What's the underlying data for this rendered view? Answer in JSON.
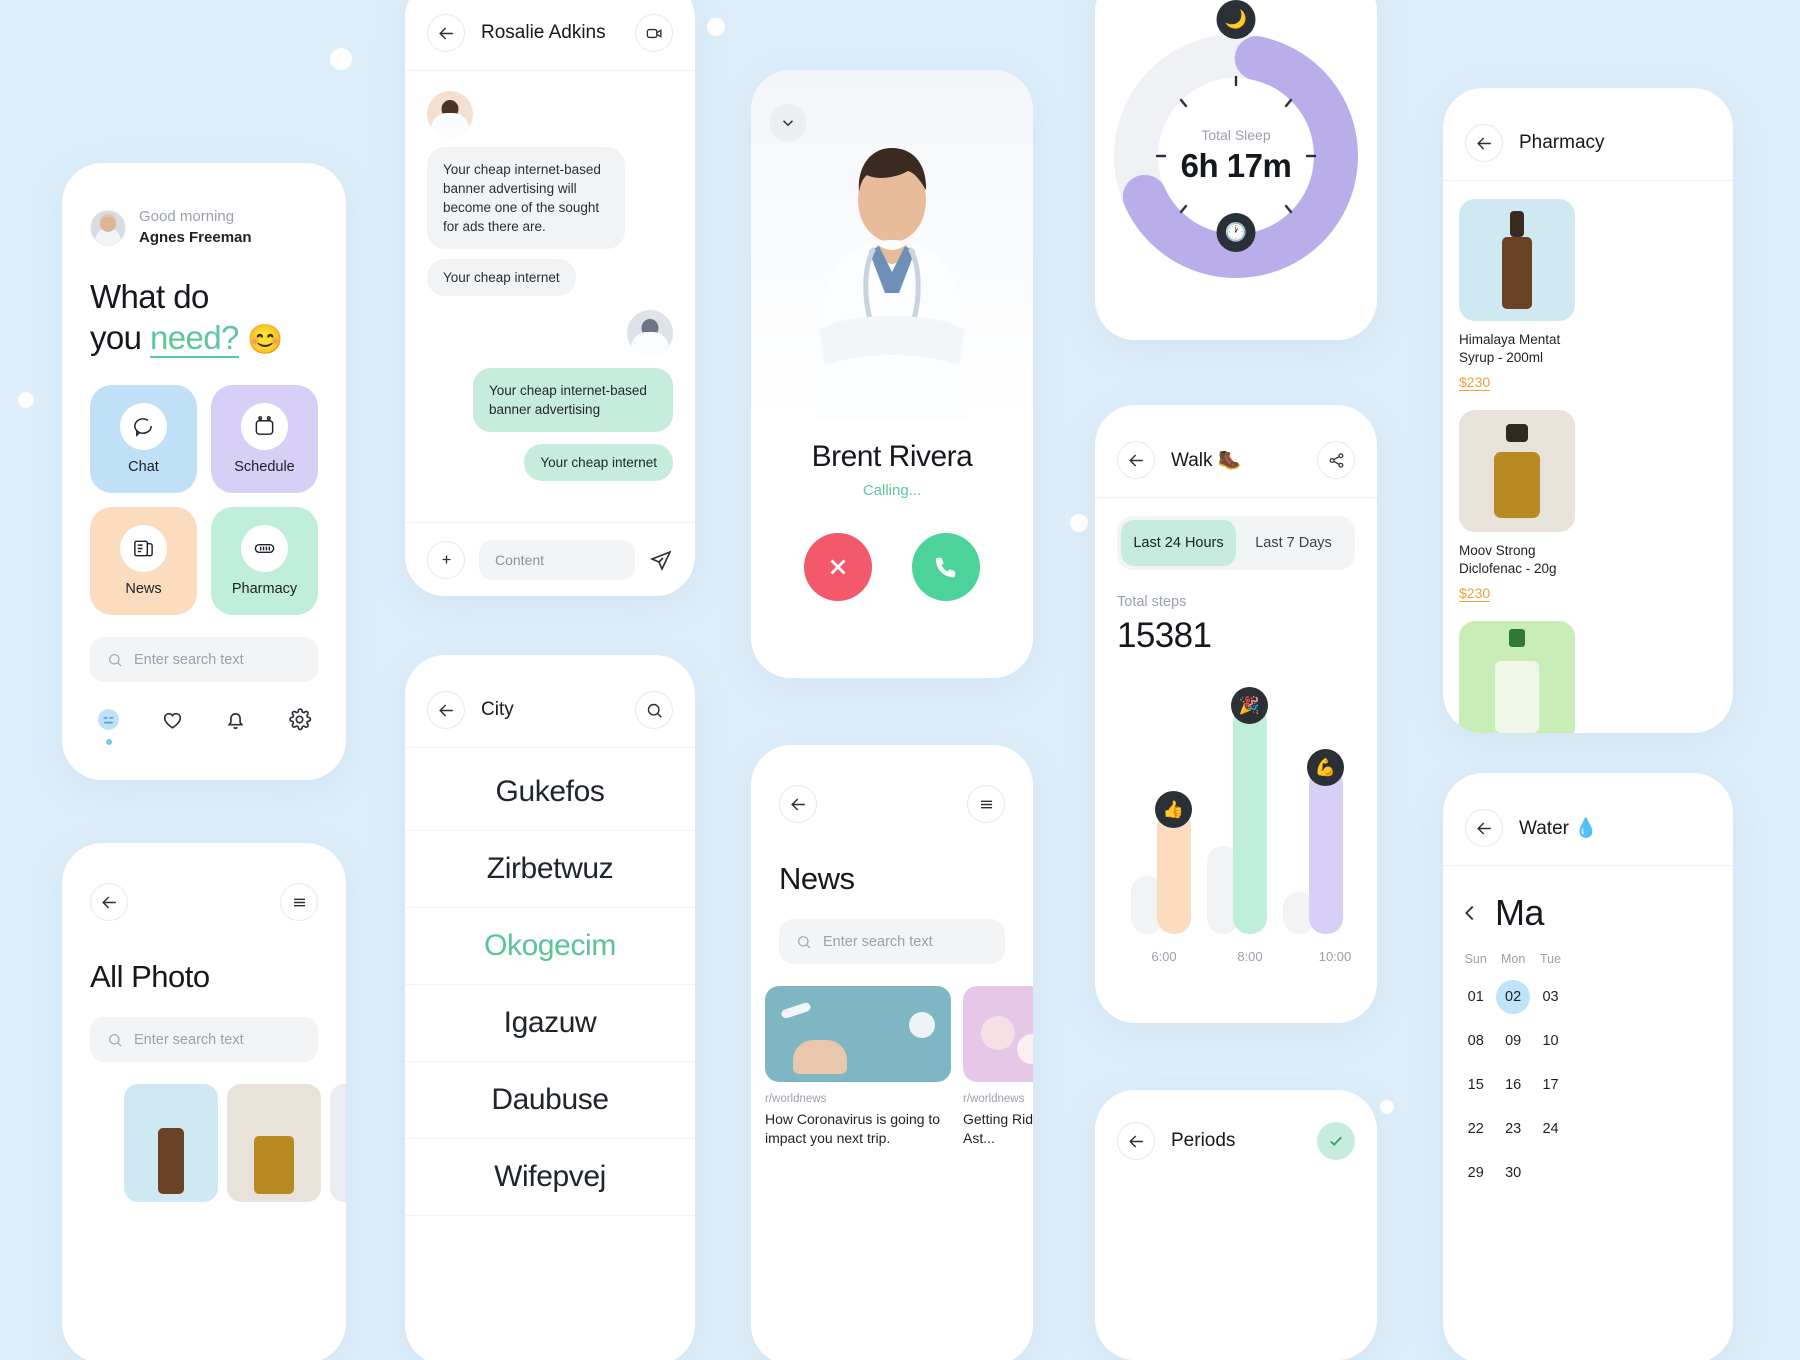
{
  "theme": {
    "bg": "#ddeefa",
    "accent_green": "#5cc79b",
    "mint": "#c6ecdd",
    "blue_tile": "#bfe0f7",
    "purple_tile": "#d7cff5",
    "peach_tile": "#fbdcbf",
    "ring_purple": "#b9aeea",
    "price_gold": "#e8a33d"
  },
  "home": {
    "greeting": "Good morning",
    "user_name": "Agnes Freeman",
    "headline_1": "What do",
    "headline_2": "you ",
    "headline_link": "need?",
    "headline_emoji": "😊",
    "tiles": [
      {
        "label": "Chat",
        "icon": "chat-bubble-icon",
        "color": "#bfe0f7"
      },
      {
        "label": "Schedule",
        "icon": "calendar-icon",
        "color": "#d7cff5"
      },
      {
        "label": "News",
        "icon": "newspaper-icon",
        "color": "#fbdcbf"
      },
      {
        "label": "Pharmacy",
        "icon": "pill-capsule-icon",
        "color": "#bfeeda"
      }
    ],
    "search_placeholder": "Enter search text",
    "nav": [
      {
        "name": "smiley-face-icon",
        "active": true
      },
      {
        "name": "heart-icon",
        "active": false
      },
      {
        "name": "bell-icon",
        "active": false
      },
      {
        "name": "gear-icon",
        "active": false
      }
    ]
  },
  "photo": {
    "title": "All Photo",
    "search_placeholder": "Enter search text",
    "back_icon": "back-arrow-icon",
    "menu_icon": "hamburger-menu-icon",
    "thumbs": [
      {
        "bg": "#cfe9f2",
        "bottle": "#6b4224"
      },
      {
        "bg": "#e8e3da",
        "bottle": "#b98a22"
      },
      {
        "bg": "#e9edf0",
        "bottle": "#ffffff"
      }
    ]
  },
  "chat": {
    "contact_name": "Rosalie Adkins",
    "back_icon": "back-arrow-icon",
    "video_icon": "video-camera-icon",
    "messages": [
      {
        "side": "in",
        "text": "Your cheap internet-based banner advertising will become one of the sought for ads there are."
      },
      {
        "side": "in",
        "text": "Your cheap internet"
      },
      {
        "side": "out",
        "text": "Your cheap internet-based banner advertising"
      },
      {
        "side": "out",
        "text": "Your cheap internet"
      }
    ],
    "input_placeholder": "Content",
    "plus_icon": "plus-circle-icon",
    "send_icon": "send-paper-plane-icon"
  },
  "city": {
    "title": "City",
    "back_icon": "back-arrow-icon",
    "search_icon": "search-icon",
    "items": [
      {
        "name": "Gukefos",
        "selected": false
      },
      {
        "name": "Zirbetwuz",
        "selected": false
      },
      {
        "name": "Okogecim",
        "selected": true
      },
      {
        "name": "Igazuw",
        "selected": false
      },
      {
        "name": "Daubuse",
        "selected": false
      },
      {
        "name": "Wifepvej",
        "selected": false
      }
    ]
  },
  "call": {
    "doctor_name": "Brent Rivera",
    "status": "Calling...",
    "collapse_icon": "chevron-down-icon",
    "decline_icon": "close-x-icon",
    "accept_icon": "phone-icon",
    "decline_color": "#f3586b",
    "accept_color": "#4bd39b"
  },
  "news": {
    "title": "News",
    "search_placeholder": "Enter search text",
    "back_icon": "back-arrow-icon",
    "menu_icon": "hamburger-menu-icon",
    "articles": [
      {
        "source": "r/worldnews",
        "headline": "How Coronavirus is going to impact you next trip.",
        "img": "#7fb6c4"
      },
      {
        "source": "r/worldnews",
        "headline": "Getting Rid Of Worries On Ast...",
        "img": "#e6c7e8"
      }
    ]
  },
  "sleep": {
    "label": "Total Sleep",
    "value": "6h 17m",
    "moon_icon": "🌙",
    "clock_icon": "🕐",
    "ring_color": "#b9aeea",
    "track_color": "#f0f1f4"
  },
  "walk": {
    "title": "Walk",
    "title_emoji": "🥾",
    "back_icon": "back-arrow-icon",
    "share_icon": "share-icon",
    "tabs": [
      {
        "label": "Last 24 Hours",
        "active": true
      },
      {
        "label": "Last 7 Days",
        "active": false
      }
    ],
    "total_label": "Total steps",
    "total_value": "15381"
  },
  "chart_data": {
    "type": "bar",
    "title": "Total steps",
    "categories": [
      "6:00",
      "8:00",
      "10:00"
    ],
    "values": [
      2900,
      6600,
      4300
    ],
    "ylim": [
      0,
      7200
    ],
    "xlabel": "",
    "ylabel": "",
    "grid": false,
    "legend": "none",
    "series": [
      {
        "name": "steps",
        "values": [
          2900,
          6600,
          4300
        ]
      }
    ],
    "bar_colors": [
      "#fbdcbf",
      "#bfeeda",
      "#d7cff5"
    ],
    "bar_badges": [
      "👍",
      "🎉",
      "💪"
    ],
    "ghost_bars": [
      1400,
      2100,
      1000
    ],
    "ghost_color": "#f2f3f5",
    "tick_labels": [
      "6:00",
      "8:00",
      "10:00"
    ]
  },
  "periods": {
    "title": "Periods",
    "back_icon": "back-arrow-icon",
    "check_icon": "check-icon"
  },
  "pharmacy": {
    "title": "Pharmacy",
    "back_icon": "back-arrow-icon",
    "products": [
      {
        "name": "Himalaya Mentat Syrup - 200ml",
        "price": "$230",
        "bg": "#cfe9f2",
        "bottle": "#6b4224"
      },
      {
        "name": "Moov Strong Diclofenac - 20g",
        "price": "$230",
        "bg": "#e8e3da",
        "bottle": "#b98a22"
      },
      {
        "name": "",
        "price": "",
        "bg": "#c9edb6",
        "bottle": "#e8f3e0"
      }
    ]
  },
  "water": {
    "title": "Water",
    "title_emoji": "💧",
    "back_icon": "back-arrow-icon",
    "prev_icon": "chevron-left-icon",
    "month": "Ma",
    "dow": [
      "Sun",
      "Mon",
      "Tue"
    ],
    "weeks": [
      [
        "01",
        "02",
        "03"
      ],
      [
        "08",
        "09",
        "10"
      ],
      [
        "15",
        "16",
        "17"
      ],
      [
        "22",
        "23",
        "24"
      ],
      [
        "29",
        "30",
        ""
      ]
    ],
    "selected_day": "02"
  }
}
